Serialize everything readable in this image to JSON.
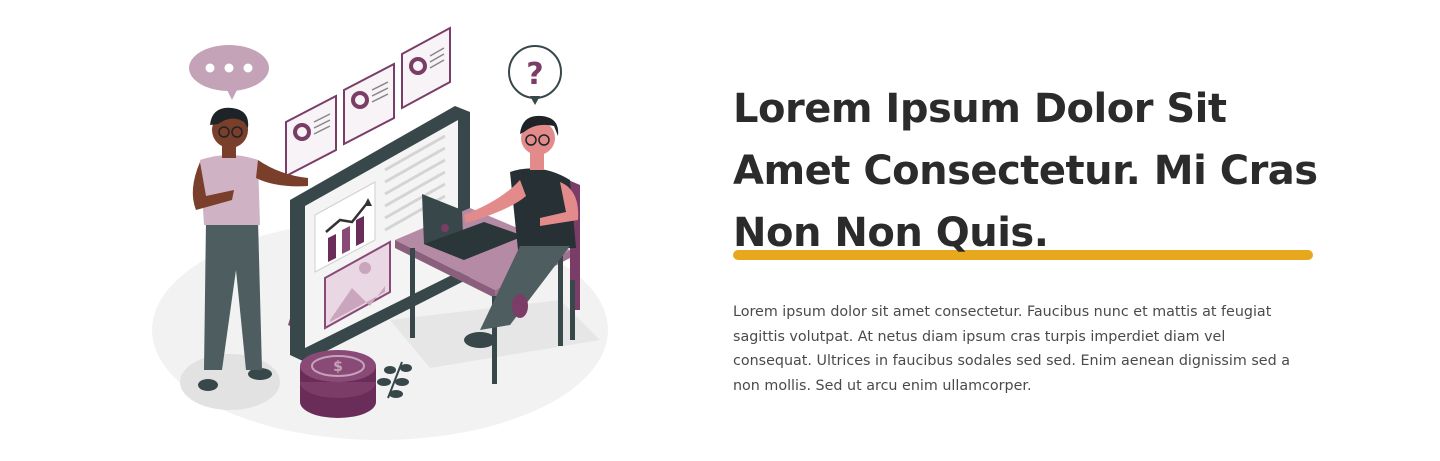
{
  "hero": {
    "headline_line1": "Lorem Ipsum Dolor Sit",
    "headline_line2": "Amet Consectetur. Mi Cras",
    "headline_line3": "Non Non Quis.",
    "body": "Lorem ipsum dolor sit amet consectetur. Faucibus nunc et mattis at feugiat sagittis volutpat. At netus diam ipsum cras turpis imperdiet diam vel consequat. Ultrices in faucibus sodales sed sed. Enim aenean dignissim sed a non mollis. Sed ut arcu enim ullamcorper.",
    "highlight_color": "#e8a81d",
    "accent_color": "#7b3d67"
  },
  "illustration": {
    "speech_bubble_icon": "speech-bubble-dots-icon",
    "question_icon": "question-mark-icon",
    "chart_icon": "bar-chart-trend-icon",
    "coin_icon": "dollar-coin-icon"
  }
}
